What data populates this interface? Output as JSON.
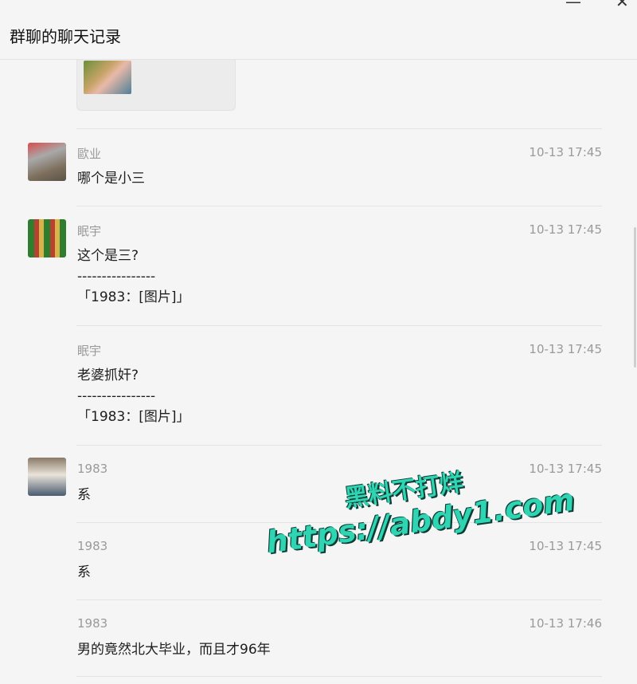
{
  "window": {
    "title": "群聊的聊天记录",
    "minimize_label": "—",
    "close_label": "✕"
  },
  "messages": [
    {
      "sender": "歐业",
      "time": "10-13 17:45",
      "text": "哪个是小三",
      "avatar": "photo-avatar"
    },
    {
      "sender": "眠宇",
      "time": "10-13 17:45",
      "text": "这个是三?\n----------------\n「1983：[图片]」",
      "avatar": "game-avatar"
    },
    {
      "sender": "眠宇",
      "time": "10-13 17:45",
      "text": "老婆抓奸?\n----------------\n「1983：[图片]」"
    },
    {
      "sender": "1983",
      "time": "10-13 17:45",
      "text": "系",
      "avatar": "person-avatar"
    },
    {
      "sender": "1983",
      "time": "10-13 17:45",
      "text": "系"
    },
    {
      "sender": "1983",
      "time": "10-13 17:46",
      "text": "男的竟然北大毕业，而且才96年"
    }
  ],
  "watermark": {
    "line1": "黑料不打烊",
    "line2": "https://abdy1.com"
  }
}
